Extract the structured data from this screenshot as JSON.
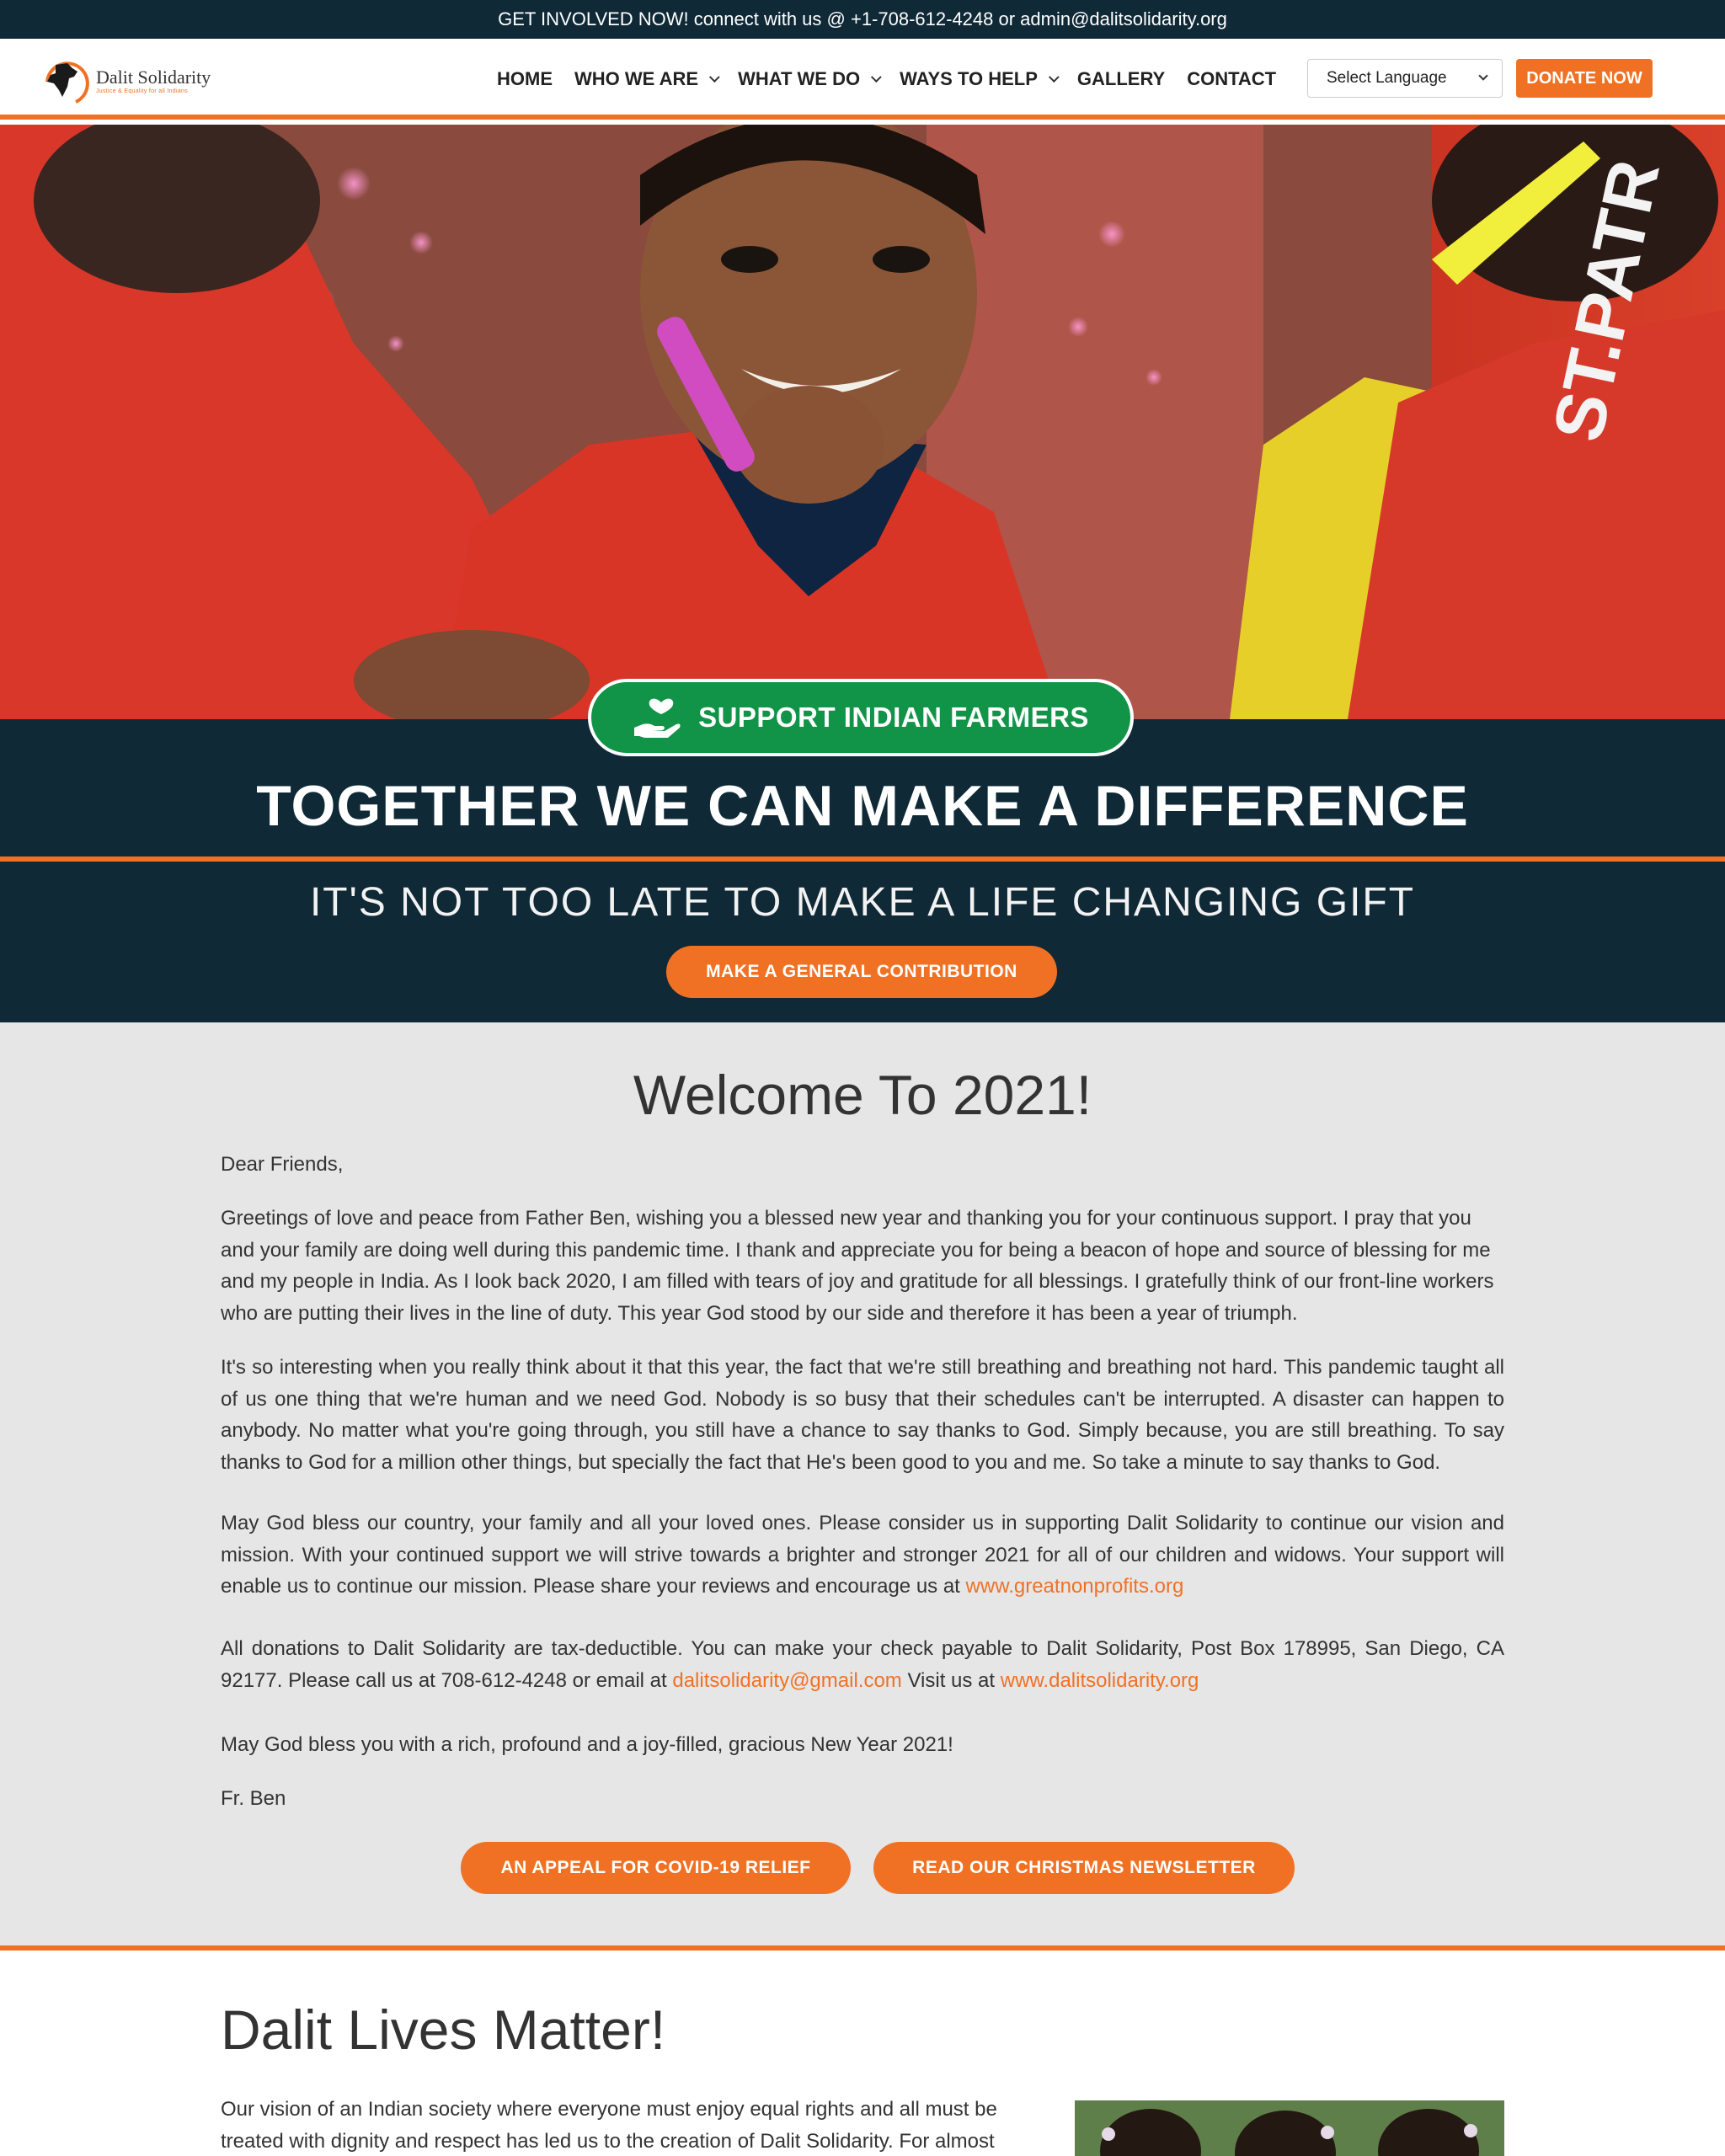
{
  "topbar": {
    "text": "GET INVOLVED NOW! connect with us @ +1-708-612-4248 or admin@dalitsolidarity.org"
  },
  "logo": {
    "name": "Dalit Solidarity",
    "tagline": "Justice & Equality for all Indians"
  },
  "nav": {
    "items": [
      {
        "label": "HOME",
        "dropdown": false
      },
      {
        "label": "WHO WE ARE",
        "dropdown": true
      },
      {
        "label": "WHAT WE DO",
        "dropdown": true
      },
      {
        "label": "WAYS TO HELP",
        "dropdown": true
      },
      {
        "label": "GALLERY",
        "dropdown": false
      },
      {
        "label": "CONTACT",
        "dropdown": false
      }
    ],
    "language": "Select Language",
    "donate": "DONATE NOW"
  },
  "hero": {
    "farmers_button": "SUPPORT INDIAN FARMERS",
    "headline": "TOGETHER WE CAN MAKE A DIFFERENCE",
    "subhead": "IT'S NOT TOO LATE TO MAKE A LIFE CHANGING GIFT",
    "contribute_button": "MAKE A GENERAL CONTRIBUTION",
    "shirt_text": "ST.PATR"
  },
  "welcome": {
    "title": "Welcome To 2021!",
    "greeting": "Dear Friends,",
    "p1": "Greetings of love and peace from Father Ben, wishing you a blessed new year and thanking you for your continuous support. I pray that you and your family are doing well during this pandemic time. I thank and appreciate you for being a beacon of hope and source of blessing for me and my people in India. As I look back 2020, I am filled with tears of joy and gratitude for all blessings. I gratefully think of our front-line workers who are putting their lives in the line of duty. This year God stood by our side and therefore it has been a year of triumph.",
    "p2": "It's so interesting when you really think about it that this year, the fact that we're still breathing and breathing not hard. This pandemic taught all of us one thing that we're human and we need God. Nobody is so busy that their schedules can't be interrupted. A disaster can happen to anybody. No matter what you're going through, you still have a chance to say thanks to God. Simply because, you are still breathing. To say thanks to God for a million other things, but specially the fact that He's been good to you and me. So take a minute to say thanks to God.",
    "p3": "May God bless our country, your family and all your loved ones. Please consider us in supporting Dalit Solidarity to continue our vision and mission. With your continued support we will strive towards a brighter and stronger 2021 for all of our children and widows. Your support will enable us to continue our mission. Please share your reviews and encourage us at ",
    "p3_link": "www.greatnonprofits.org",
    "p4": "All donations to Dalit Solidarity are tax-deductible. You can make your check payable to Dalit Solidarity, Post Box 178995, San Diego, CA 92177. Please call us at 708-612-4248 or email at ",
    "p4_email": "dalitsolidarity@gmail.com",
    "p4_mid": " Visit us at ",
    "p4_link": "www.dalitsolidarity.org",
    "p5": "May God bless you with a rich, profound and a joy-filled, gracious  New Year 2021!",
    "signoff": "Fr. Ben",
    "covid_button": "AN APPEAL FOR COVID-19 RELIEF",
    "newsletter_button": "READ OUR CHRISTMAS NEWSLETTER"
  },
  "dlm": {
    "title": "Dalit Lives Matter!",
    "text": "Our vision of an Indian society where everyone must enjoy equal rights and all must be treated with dignity and respect has led us to the creation of Dalit Solidarity. For almost"
  },
  "colors": {
    "navy": "#0f2937",
    "orange": "#f07124",
    "green": "#119447",
    "section_bg": "#e6e6e6"
  }
}
